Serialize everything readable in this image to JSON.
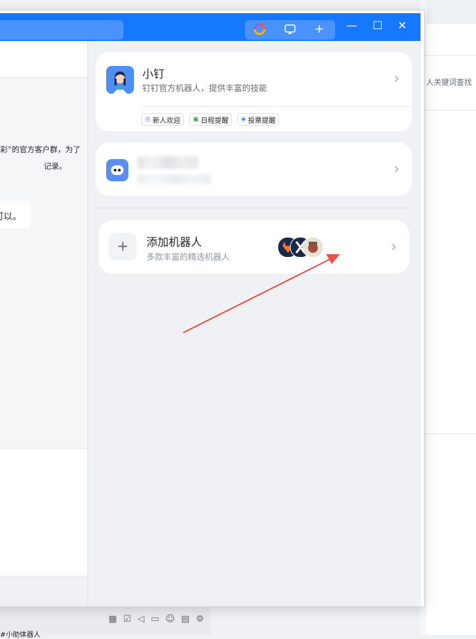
{
  "background_app": {
    "search_hint": "人关键词查找",
    "bottom_tag": "#小助体器人",
    "toolbar_icons": [
      "calendar-icon",
      "task-icon",
      "voice-icon",
      "folder-icon",
      "contact-icon",
      "search-doc-icon",
      "settings-icon"
    ]
  },
  "chat": {
    "message_line1": "彩”的官方客户群，为了",
    "message_line2": "记录。",
    "bubble_text": "可以。"
  },
  "titlebar": {
    "tools": [
      "color-logo-icon",
      "screen-cast-icon",
      "plus-icon"
    ],
    "window_controls": [
      "minimize-icon",
      "maximize-icon",
      "close-icon"
    ]
  },
  "robots": [
    {
      "name": "小钉",
      "description": "钉钉官方机器人，提供丰富的技能",
      "tags": [
        "新人欢迎",
        "日程提醒",
        "投票提醒"
      ]
    }
  ],
  "add_robot": {
    "title": "添加机器人",
    "description": "多款丰富的精选机器人"
  },
  "colors": {
    "accent": "#1677ff",
    "panel_bg": "#f0f1f4",
    "annotation_arrow": "#e8504a"
  }
}
